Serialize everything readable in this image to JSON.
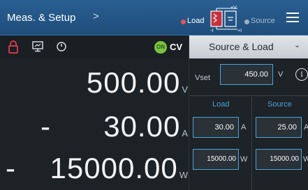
{
  "header": {
    "title": "Meas. & Setup",
    "arrow": ">",
    "mode_load": "Load",
    "mode_source": "Source",
    "diagram_top": "+V",
    "diagram_left": "-I",
    "diagram_right": "+I"
  },
  "status": {
    "output_badge": "ON",
    "mode": "CV"
  },
  "readouts": {
    "voltage": {
      "value": "500.00",
      "unit": "V"
    },
    "current": {
      "sign": "-",
      "value": "30.00",
      "unit": "A"
    },
    "power": {
      "sign": "-",
      "value": "15000.00",
      "unit": "W"
    }
  },
  "panel": {
    "selector": "Source & Load",
    "vset_label": "Vset",
    "vset_value": "450.00",
    "vset_unit": "V",
    "load_header": "Load",
    "source_header": "Source",
    "load_current": "30.00",
    "load_current_unit": "A",
    "source_current": "25.00",
    "source_current_unit": "A",
    "load_power": "15000.00",
    "load_power_unit": "W",
    "source_power": "15000.00",
    "source_power_unit": "W"
  },
  "colors": {
    "header_bg": "#1e4d7b",
    "accent": "#4aa1d6",
    "on_badge": "#7ac141",
    "load_dot": "#e8515e",
    "lock_icon": "#e23b4d"
  },
  "icons": [
    "lock-icon",
    "monitor-icon",
    "timer-icon",
    "menu-icon",
    "info-icon",
    "chevron-down-icon",
    "load-source-diagram-icon"
  ]
}
